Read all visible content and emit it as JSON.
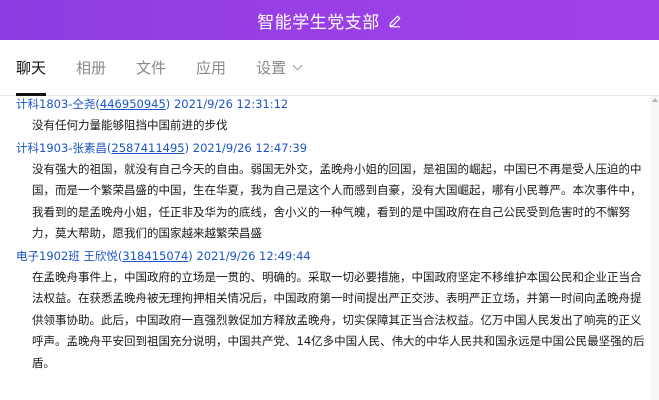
{
  "window": {
    "title": "智能学生党支部"
  },
  "tabs": [
    {
      "label": "聊天",
      "active": true
    },
    {
      "label": "相册",
      "active": false
    },
    {
      "label": "文件",
      "active": false
    },
    {
      "label": "应用",
      "active": false
    },
    {
      "label": "设置",
      "active": false
    }
  ],
  "messages": [
    {
      "sender": "计科1803-仝尧",
      "qq": "446950945",
      "time": "2021/9/26 12:31:12",
      "text": "没有任何力量能够阻挡中国前进的步伐"
    },
    {
      "sender": "计科1903-张素昌",
      "qq": "2587411495",
      "time": "2021/9/26 12:47:39",
      "text": "没有强大的祖国，就没有自己今天的自由。弱国无外交，孟晚舟小姐的回国，是祖国的崛起，中国已不再是受人压迫的中国，而是一个繁荣昌盛的中国，生在华夏，我为自己是这个人而感到自豪，没有大国崛起，哪有小民尊严。本次事件中，我看到的是孟晚舟小姐，任正非及华为的底线，舍小义的一种气魄，看到的是中国政府在自己公民受到危害时的不懈努力，莫大帮助，愿我们的国家越来越繁荣昌盛"
    },
    {
      "sender": "电子1902班 王欣悦",
      "qq": "318415074",
      "time": "2021/9/26 12:49:44",
      "text": "在孟晚舟事件上，中国政府的立场是一贯的、明确的。采取一切必要措施，中国政府坚定不移维护本国公民和企业正当合法权益。在获悉孟晚舟被无理拘押相关情况后，中国政府第一时间提出严正交涉、表明严正立场，并第一时间向孟晚舟提供领事协助。此后，中国政府一直强烈敦促加方释放孟晚舟，切实保障其正当合法权益。亿万中国人民发出了响亮的正义呼声。孟晚舟平安回到祖国充分说明，中国共产党、14亿多中国人民、伟大的中华人民共和国永远是中国公民最坚强的后盾。"
    }
  ],
  "icons": {
    "edit": "pencil-icon",
    "settings_dropdown": "chevron-down-icon"
  },
  "colors": {
    "titlebar": "#9a3fe6",
    "sender_link": "#1a55c8"
  }
}
